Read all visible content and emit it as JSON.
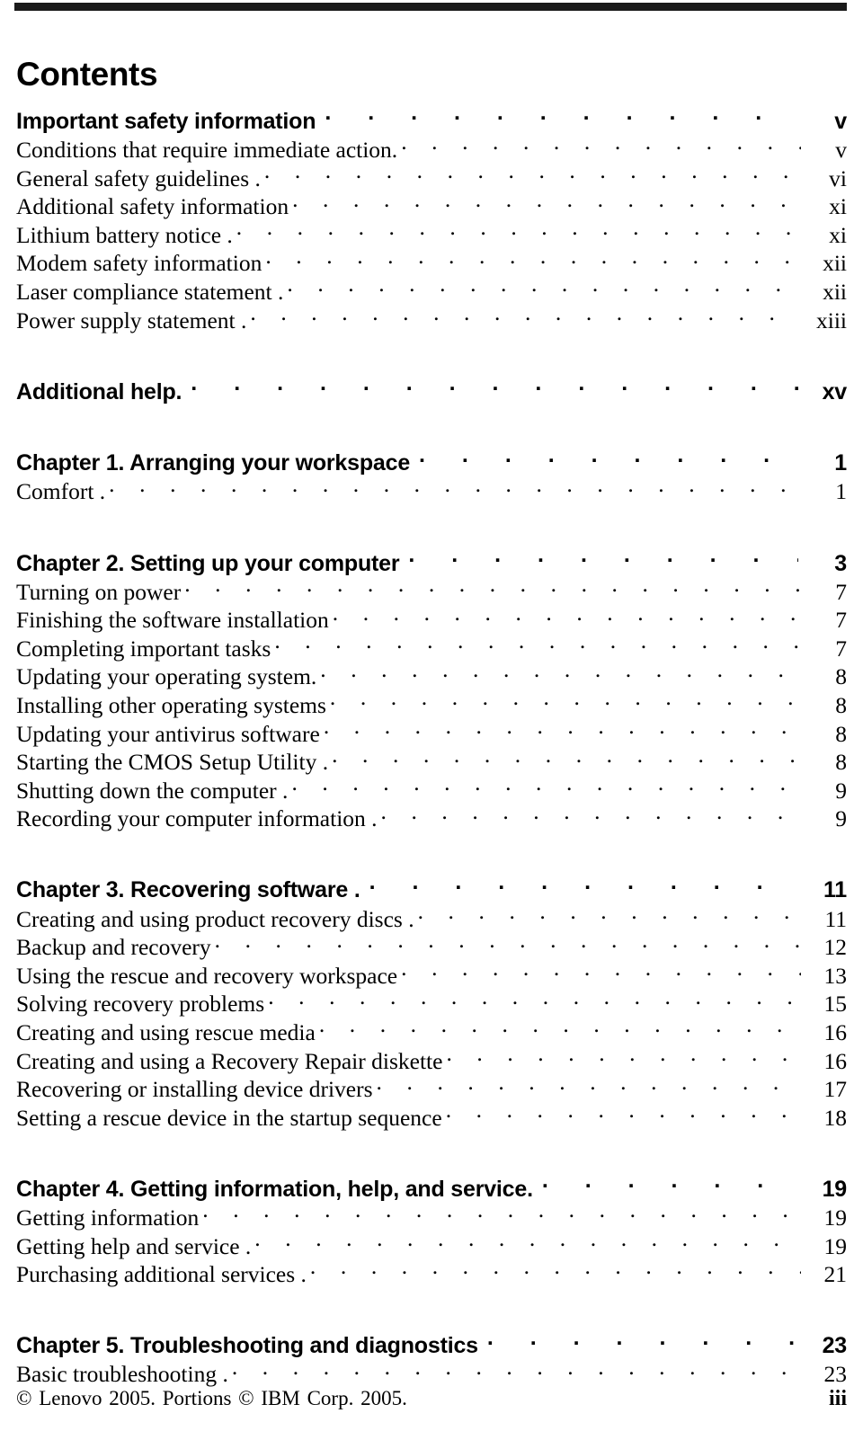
{
  "document": {
    "title": "Contents",
    "top_rule": true
  },
  "toc": {
    "sections": [
      {
        "id": "front-matter",
        "gap_before": false,
        "entries": [
          {
            "level": 1,
            "title": "Important safety information",
            "page": "v"
          },
          {
            "level": 2,
            "title": "Conditions that require immediate action.",
            "page": "v"
          },
          {
            "level": 2,
            "title": "General safety guidelines .",
            "page": "vi"
          },
          {
            "level": 2,
            "title": "Additional safety information",
            "page": "xi"
          },
          {
            "level": 2,
            "title": "Lithium battery notice .",
            "page": "xi"
          },
          {
            "level": 2,
            "title": "Modem safety information",
            "page": "xii"
          },
          {
            "level": 2,
            "title": "Laser compliance statement .",
            "page": "xii"
          },
          {
            "level": 2,
            "title": "Power supply statement .",
            "page": "xiii"
          }
        ]
      },
      {
        "id": "additional-help",
        "gap_before": true,
        "entries": [
          {
            "level": 1,
            "title": "Additional help.",
            "page": "xv"
          }
        ]
      },
      {
        "id": "chapter-1",
        "gap_before": true,
        "entries": [
          {
            "level": 1,
            "title": "Chapter 1. Arranging your workspace",
            "page": "1"
          },
          {
            "level": 2,
            "title": "Comfort .",
            "page": "1"
          }
        ]
      },
      {
        "id": "chapter-2",
        "gap_before": true,
        "entries": [
          {
            "level": 1,
            "title": "Chapter 2. Setting up your computer",
            "page": "3"
          },
          {
            "level": 2,
            "title": "Turning on power",
            "page": "7"
          },
          {
            "level": 2,
            "title": "Finishing the software installation",
            "page": "7"
          },
          {
            "level": 2,
            "title": "Completing important tasks",
            "page": "7"
          },
          {
            "level": 2,
            "title": "Updating your operating system.",
            "page": "8"
          },
          {
            "level": 2,
            "title": "Installing other operating systems",
            "page": "8"
          },
          {
            "level": 2,
            "title": "Updating your antivirus software",
            "page": "8"
          },
          {
            "level": 2,
            "title": "Starting the CMOS Setup Utility .",
            "page": "8"
          },
          {
            "level": 2,
            "title": "Shutting down the computer .",
            "page": "9"
          },
          {
            "level": 2,
            "title": "Recording your computer information .",
            "page": "9"
          }
        ]
      },
      {
        "id": "chapter-3",
        "gap_before": true,
        "entries": [
          {
            "level": 1,
            "title": "Chapter 3. Recovering software .",
            "page": "11"
          },
          {
            "level": 2,
            "title": "Creating and using product recovery discs .",
            "page": "11"
          },
          {
            "level": 2,
            "title": "Backup and recovery",
            "page": "12"
          },
          {
            "level": 2,
            "title": "Using the rescue and recovery workspace",
            "page": "13"
          },
          {
            "level": 2,
            "title": "Solving recovery problems",
            "page": "15"
          },
          {
            "level": 2,
            "title": "Creating and using rescue media",
            "page": "16"
          },
          {
            "level": 2,
            "title": "Creating and using a Recovery Repair diskette",
            "page": "16"
          },
          {
            "level": 2,
            "title": "Recovering or installing device drivers",
            "page": "17"
          },
          {
            "level": 2,
            "title": "Setting a rescue device in the startup sequence",
            "page": "18"
          }
        ]
      },
      {
        "id": "chapter-4",
        "gap_before": true,
        "entries": [
          {
            "level": 1,
            "title": "Chapter 4. Getting information, help, and service.",
            "page": "19"
          },
          {
            "level": 2,
            "title": "Getting information",
            "page": "19"
          },
          {
            "level": 2,
            "title": "Getting help and service .",
            "page": "19"
          },
          {
            "level": 2,
            "title": "Purchasing additional services .",
            "page": "21"
          }
        ]
      },
      {
        "id": "chapter-5",
        "gap_before": true,
        "entries": [
          {
            "level": 1,
            "title": "Chapter 5. Troubleshooting and diagnostics",
            "page": "23"
          },
          {
            "level": 2,
            "title": "Basic troubleshooting .",
            "page": "23"
          }
        ]
      }
    ]
  },
  "footer": {
    "copyright": "© Lenovo 2005. Portions © IBM Corp. 2005.",
    "folio": "iii"
  }
}
